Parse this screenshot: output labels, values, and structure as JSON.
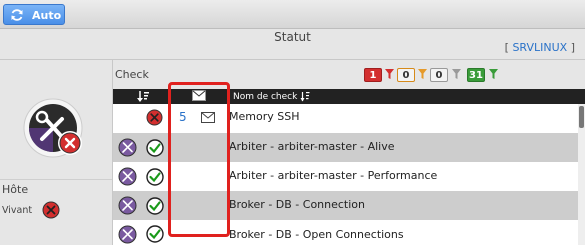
{
  "toolbar": {
    "auto_label": "Auto"
  },
  "status": {
    "title": "Statut",
    "server_open": "[ ",
    "server_name": "SRVLINUX",
    "server_close": " ]"
  },
  "host": {
    "label": "Hôte",
    "state_label": "Vivant"
  },
  "checks": {
    "label": "Check",
    "counters": {
      "critical": "1",
      "warning": "0",
      "unknown": "0",
      "ok": "31"
    },
    "columns": {
      "name": "Nom de check"
    },
    "rows": [
      {
        "state": "critical",
        "notif_count": "5",
        "name": "Memory SSH"
      },
      {
        "state": "ok",
        "notif_count": "",
        "name": "Arbiter - arbiter-master - Alive"
      },
      {
        "state": "ok",
        "notif_count": "",
        "name": "Arbiter - arbiter-master - Performance"
      },
      {
        "state": "ok",
        "notif_count": "",
        "name": "Broker - DB - Connection"
      },
      {
        "state": "ok",
        "notif_count": "",
        "name": "Broker - DB - Open Connections"
      }
    ]
  },
  "colors": {
    "accent": "#4a8fe8",
    "critical": "#d32f2f",
    "warning": "#d68a1a",
    "ok": "#3a9c3a",
    "highlight": "#e0211e"
  }
}
